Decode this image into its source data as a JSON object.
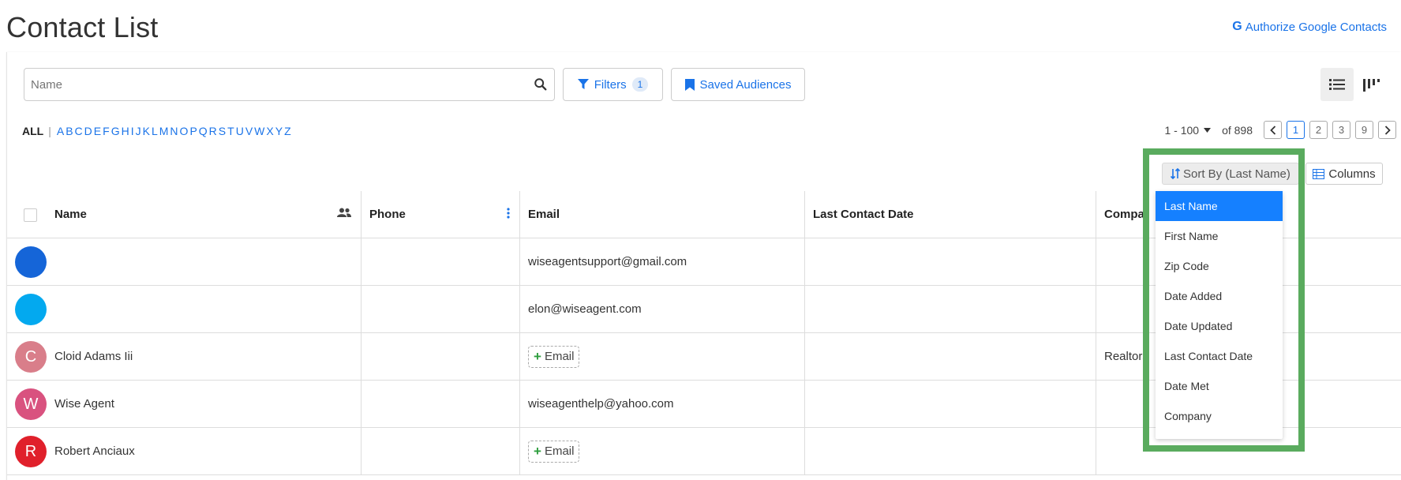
{
  "page": {
    "title": "Contact List",
    "google_auth": "Authorize Google Contacts"
  },
  "search": {
    "placeholder": "Name"
  },
  "filters": {
    "label": "Filters",
    "count": "1"
  },
  "saved_audiences": {
    "label": "Saved Audiences"
  },
  "alphabet": {
    "all": "ALL",
    "separator": "|",
    "letters": [
      "A",
      "B",
      "C",
      "D",
      "E",
      "F",
      "G",
      "H",
      "I",
      "J",
      "K",
      "L",
      "M",
      "N",
      "O",
      "P",
      "Q",
      "R",
      "S",
      "T",
      "U",
      "V",
      "W",
      "X",
      "Y",
      "Z"
    ]
  },
  "pagination": {
    "range": "1 - 100",
    "total": "of 898",
    "pages": [
      "1",
      "2",
      "3",
      "9"
    ],
    "current": "1"
  },
  "sort": {
    "label": "Sort By (Last Name)",
    "options": [
      "Last Name",
      "First Name",
      "Zip Code",
      "Date Added",
      "Date Updated",
      "Last Contact Date",
      "Date Met",
      "Company"
    ],
    "selected": "Last Name"
  },
  "columns_button": {
    "label": "Columns"
  },
  "table": {
    "headers": {
      "name": "Name",
      "phone": "Phone",
      "email": "Email",
      "last_contact": "Last Contact Date",
      "company": "Compa"
    },
    "rows": [
      {
        "initial": "",
        "avatar_color": "#1565d8",
        "name": "",
        "phone": "",
        "email": "wiseagentsupport@gmail.com",
        "add_email": "",
        "last_contact": "",
        "company": ""
      },
      {
        "initial": "",
        "avatar_color": "#03a9ef",
        "name": "",
        "phone": "",
        "email": "elon@wiseagent.com",
        "add_email": "",
        "last_contact": "",
        "company": ""
      },
      {
        "initial": "C",
        "avatar_color": "#d97e8a",
        "name": "Cloid Adams Iii",
        "phone": "",
        "email": "",
        "add_email": "Email",
        "last_contact": "",
        "company": "Realtors"
      },
      {
        "initial": "W",
        "avatar_color": "#d9527f",
        "name": "Wise Agent",
        "phone": "",
        "email": "wiseagenthelp@yahoo.com",
        "add_email": "",
        "last_contact": "",
        "company": ""
      },
      {
        "initial": "R",
        "avatar_color": "#e0202b",
        "name": "Robert Anciaux",
        "phone": "",
        "email": "",
        "add_email": "Email",
        "last_contact": "",
        "company": ""
      }
    ]
  },
  "colors": {
    "accent": "#1a73e8",
    "selected": "#1580ff",
    "highlight": "#5aab5e"
  },
  "icons": {
    "search": "search-icon",
    "filter": "filter-icon",
    "bookmark": "bookmark-icon",
    "list": "list-view-icon",
    "kanban": "kanban-view-icon",
    "sort": "sort-icon",
    "columns": "columns-icon"
  }
}
